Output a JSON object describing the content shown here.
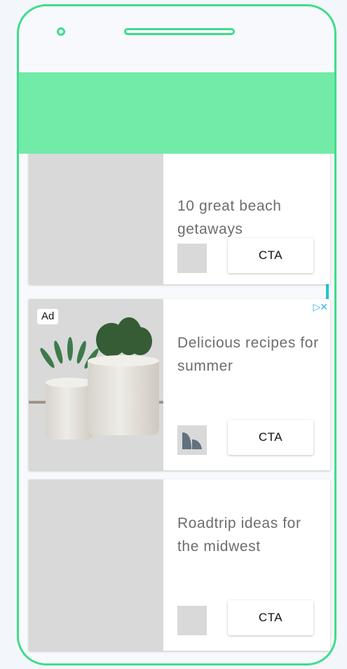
{
  "ad_label": "Ad",
  "cards": [
    {
      "headline": "10 great beach getaways",
      "cta": "CTA"
    },
    {
      "headline": "Delicious recipes for summer",
      "cta": "CTA"
    },
    {
      "headline": "Roadtrip ideas for the midwest",
      "cta": "CTA"
    }
  ],
  "colors": {
    "phone_frame": "#3fdd8a",
    "header_band": "#72eba8",
    "side_buttons": "#18c7d8",
    "adchoices": "#2bb7e6"
  },
  "icons": {
    "camera": "camera-icon",
    "speaker": "speaker-icon",
    "adchoices": "adchoices-icon",
    "brand_logo": "brand-logo-icon"
  }
}
